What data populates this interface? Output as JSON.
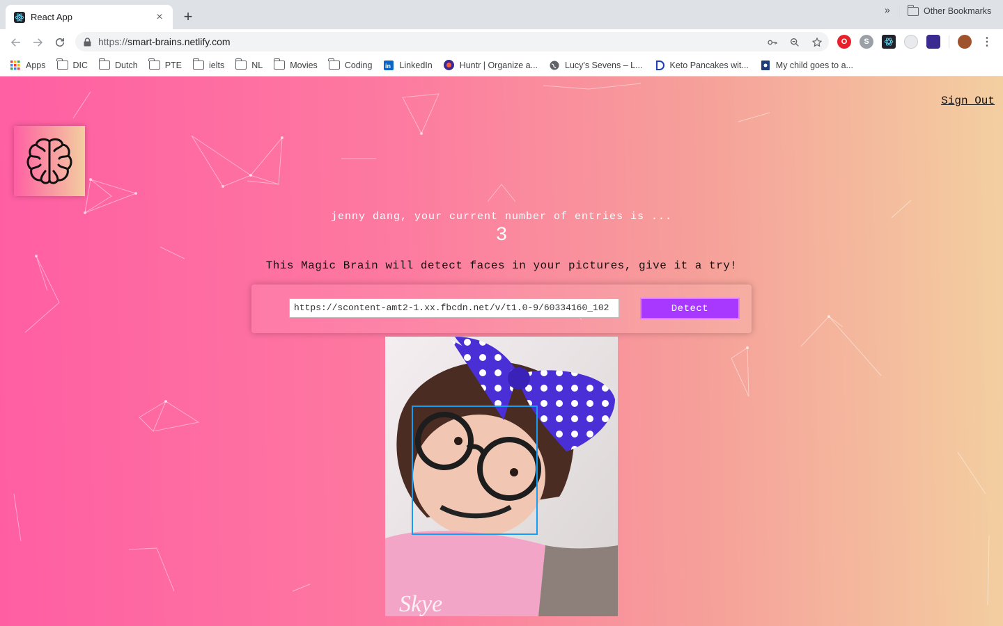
{
  "browser": {
    "tab_title": "React App",
    "tab_close": "×",
    "new_tab": "+",
    "url_protocol": "https://",
    "url_host": "smart-brains.netlify.com",
    "bookmarks": [
      {
        "label": "Apps",
        "icon": "apps-grid-icon"
      },
      {
        "label": "DIC",
        "icon": "folder-icon"
      },
      {
        "label": "Dutch",
        "icon": "folder-icon"
      },
      {
        "label": "PTE",
        "icon": "folder-icon"
      },
      {
        "label": "ielts",
        "icon": "folder-icon"
      },
      {
        "label": "NL",
        "icon": "folder-icon"
      },
      {
        "label": "Movies",
        "icon": "folder-icon"
      },
      {
        "label": "Coding",
        "icon": "folder-icon"
      },
      {
        "label": "LinkedIn",
        "icon": "linkedin-icon"
      },
      {
        "label": "Huntr | Organize a...",
        "icon": "huntr-icon"
      },
      {
        "label": "Lucy's Sevens – L...",
        "icon": "globe-icon"
      },
      {
        "label": "Keto Pancakes wit...",
        "icon": "d-logo-icon"
      },
      {
        "label": "My child goes to a...",
        "icon": "bookmark-site-icon"
      }
    ],
    "bookmarks_more": "»",
    "other_bookmarks": "Other Bookmarks"
  },
  "app": {
    "sign_out": "Sign Out",
    "rank_text": "jenny dang, your current number of entries is ...",
    "rank_count": "3",
    "intro": "This Magic Brain will detect faces in your pictures, give it a try!",
    "image_url": "https://scontent-amt2-1.xx.fbcdn.net/v/t1.0-9/60334160_102",
    "detect_label": "Detect"
  },
  "colors": {
    "gradient_start": "#ff5ea3",
    "gradient_end": "#f3cfa0",
    "detect_button": "#a838ff",
    "face_box": "#149df2"
  },
  "face_box_detected": true
}
